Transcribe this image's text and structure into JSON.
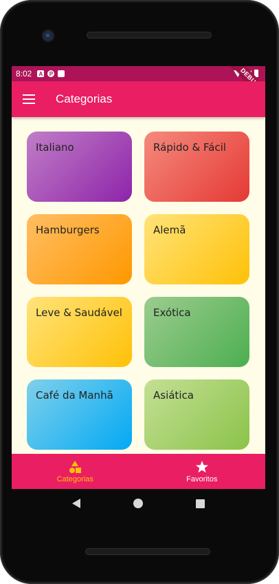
{
  "status_bar": {
    "time": "8:02",
    "notification_icons": [
      "a-icon",
      "p-icon",
      "sd-card-icon"
    ],
    "system_icons": [
      "wifi-icon",
      "signal-icon",
      "battery-icon"
    ],
    "debug_banner": "DEBUG"
  },
  "app_bar": {
    "menu_icon": "menu-icon",
    "title": "Categorias"
  },
  "categories": [
    {
      "label": "Italiano",
      "color": "#8e24aa"
    },
    {
      "label": "Rápido & Fácil",
      "color": "#e53935"
    },
    {
      "label": "Hamburgers",
      "color": "#ff9800"
    },
    {
      "label": "Alemã",
      "color": "#ffc107"
    },
    {
      "label": "Leve & Saudável",
      "color": "#ffc107"
    },
    {
      "label": "Exótica",
      "color": "#4caf50"
    },
    {
      "label": "Café da Manhã",
      "color": "#03a9f4"
    },
    {
      "label": "Asiática",
      "color": "#8bc34a"
    }
  ],
  "bottom_nav": {
    "tabs": [
      {
        "label": "Categorias",
        "icon": "category-icon",
        "active": true
      },
      {
        "label": "Favoritos",
        "icon": "star-icon",
        "active": false
      }
    ],
    "active_color": "#ffc107",
    "background": "#e91e63"
  },
  "system_nav": {
    "buttons": [
      "back-icon",
      "home-icon",
      "recents-icon"
    ]
  }
}
